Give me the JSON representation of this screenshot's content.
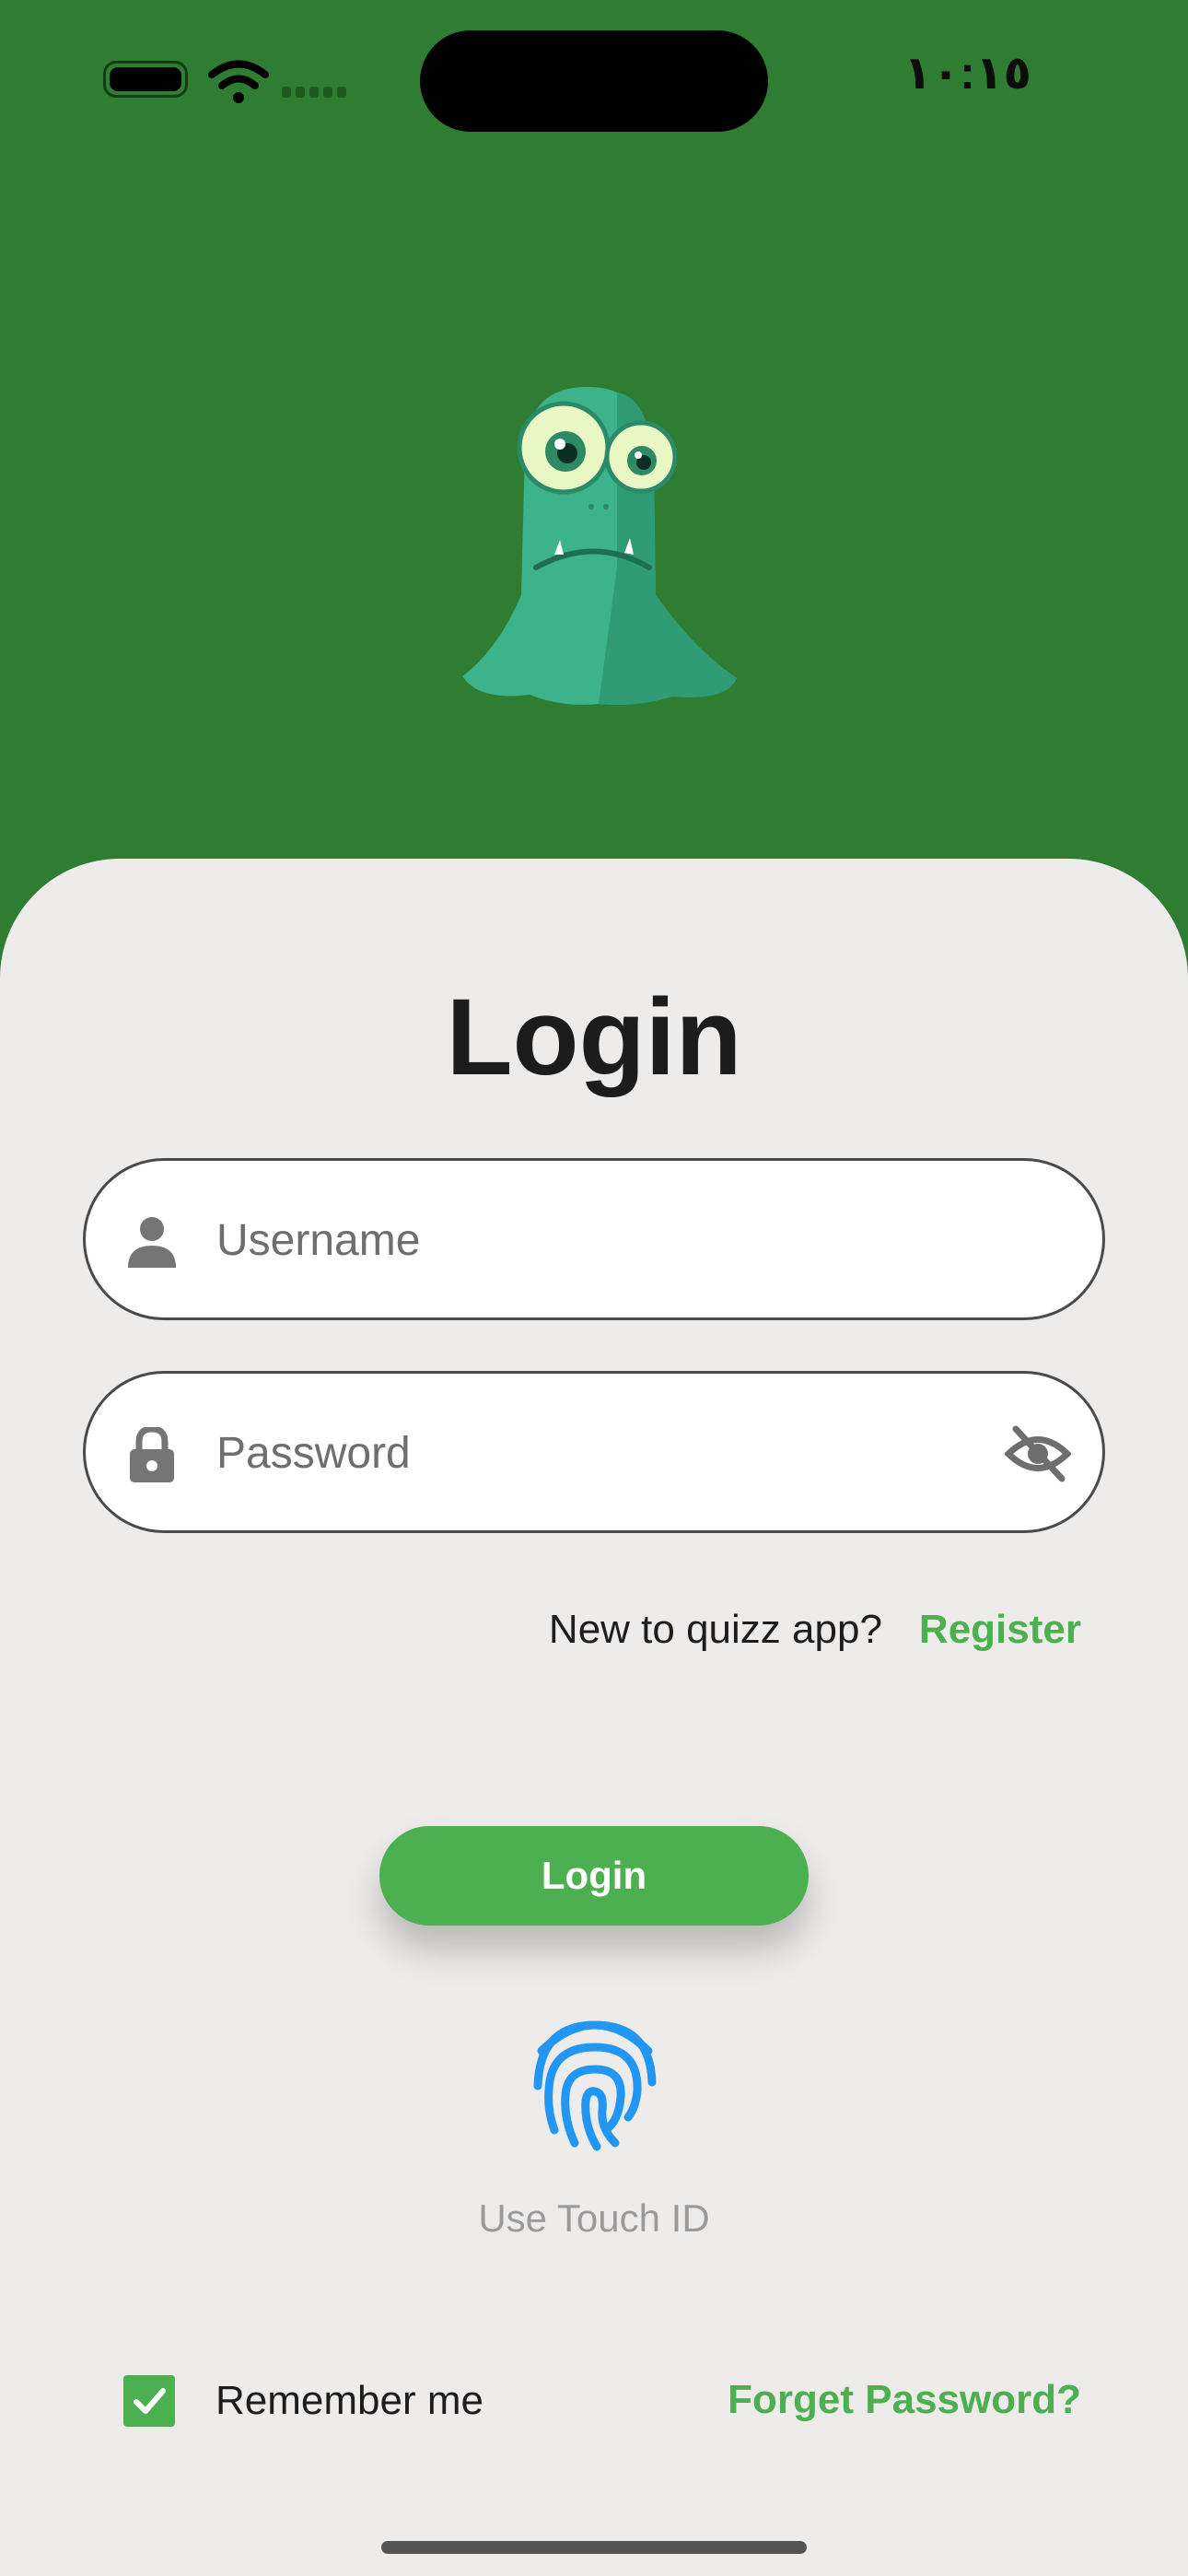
{
  "status_bar": {
    "time": "١٠:١٥"
  },
  "login": {
    "title": "Login",
    "username_placeholder": "Username",
    "password_placeholder": "Password",
    "register_prompt": "New to quizz app?",
    "register_link": "Register",
    "login_button": "Login",
    "touch_id_label": "Use Touch ID",
    "remember_me": "Remember me",
    "remember_checked": true,
    "forgot_password": "Forget Password?"
  },
  "icons": [
    "battery-icon",
    "wifi-icon",
    "signal-icon",
    "mascot-icon",
    "user-icon",
    "lock-icon",
    "eye-off-icon",
    "fingerprint-icon",
    "check-icon"
  ],
  "colors": {
    "header": "#2e7d32",
    "accent": "#4caf50",
    "card": "#eeeceb",
    "fingerprint": "#2196f3"
  }
}
